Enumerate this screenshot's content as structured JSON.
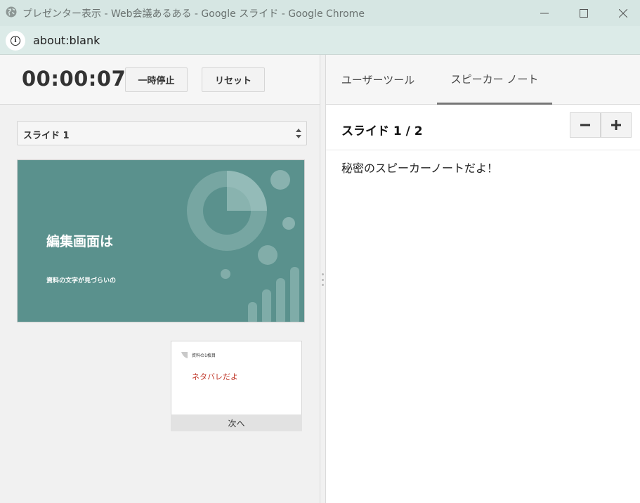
{
  "window": {
    "title": "プレゼンター表示 - Web会議あるある - Google スライド - Google Chrome",
    "minimize_glyph": "─",
    "maximize_glyph": "☐",
    "close_glyph": "✕"
  },
  "address": {
    "url": "about:blank",
    "info_icon": "info-icon"
  },
  "presenter": {
    "timer": "00:00:07",
    "pause_label": "一時停止",
    "reset_label": "リセット",
    "slide_select": "スライド 1"
  },
  "current_slide": {
    "title": "編集画面は",
    "subtitle": "資料の文字が見づらいの",
    "background": "#5a918d"
  },
  "next_slide": {
    "mini_title": "資料の1枚目",
    "text": "ネタバレだよ",
    "label": "次へ"
  },
  "tabs": [
    {
      "label": "ユーザーツール",
      "active": false
    },
    {
      "label": "スピーカー ノート",
      "active": true
    }
  ],
  "notes": {
    "counter": "スライド 1 / 2",
    "zoom_out": "−",
    "zoom_in": "+",
    "text": "秘密のスピーカーノートだよ！"
  }
}
